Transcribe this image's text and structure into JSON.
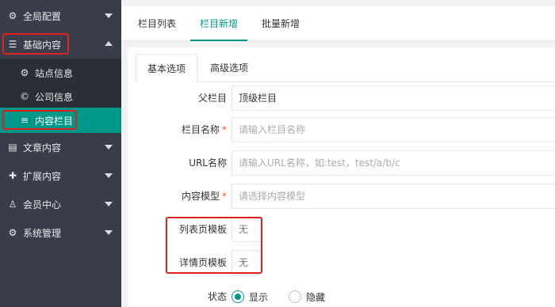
{
  "sidebar": {
    "items": [
      {
        "label": "全局配置",
        "icon": "gear-icon"
      },
      {
        "label": "基础内容",
        "icon": "sliders-icon"
      },
      {
        "label": "站点信息",
        "icon": "gear-icon"
      },
      {
        "label": "公司信息",
        "icon": "copyright-icon"
      },
      {
        "label": "内容栏目",
        "icon": "list-icon"
      },
      {
        "label": "文章内容",
        "icon": "document-icon"
      },
      {
        "label": "扩展内容",
        "icon": "puzzle-icon"
      },
      {
        "label": "会员中心",
        "icon": "user-icon"
      },
      {
        "label": "系统管理",
        "icon": "gear-icon"
      }
    ]
  },
  "header_tabs": [
    "栏目列表",
    "栏目新增",
    "批量新增"
  ],
  "panel_tabs": [
    "基本选项",
    "高级选项"
  ],
  "form": {
    "parent": {
      "label": "父栏目",
      "value": "顶级栏目"
    },
    "name": {
      "label": "栏目名称",
      "required": "*",
      "placeholder": "请输入栏目名称"
    },
    "url": {
      "label": "URL名称",
      "placeholder": "请输入URL名称，如:test，test/a/b/c"
    },
    "model": {
      "label": "内容模型",
      "required": "*",
      "placeholder": "请选择内容模型"
    },
    "list_tpl": {
      "label": "列表页模板",
      "value": "无"
    },
    "detail_tpl": {
      "label": "详情页模板",
      "value": "无"
    },
    "status": {
      "label": "状态",
      "options": [
        "显示",
        "隐藏"
      ],
      "selected": "显示"
    }
  },
  "colors": {
    "accent": "#009688",
    "sidebar": "#393d49",
    "highlight": "#e0201c"
  }
}
